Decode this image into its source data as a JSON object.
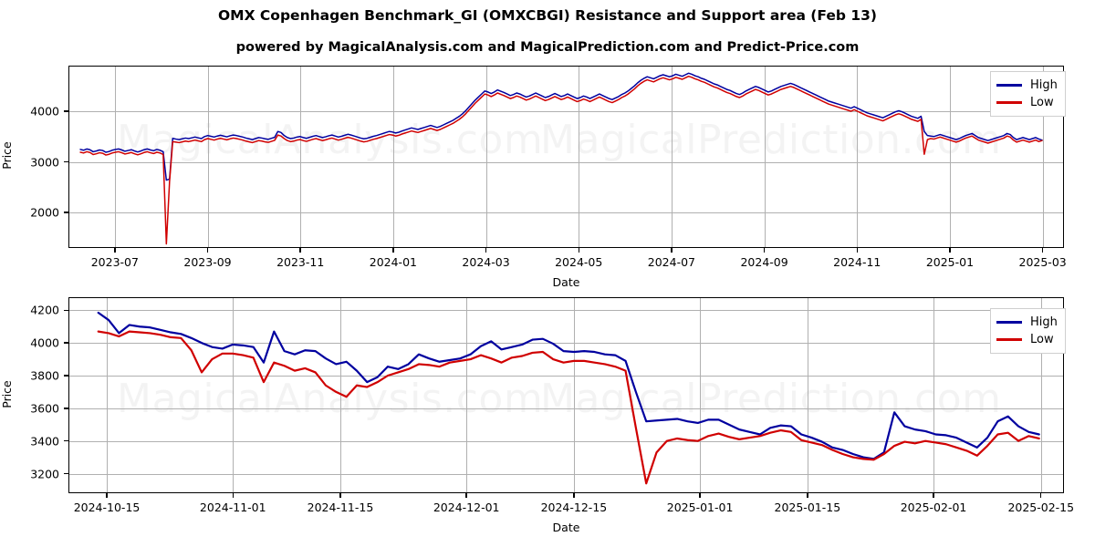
{
  "header": {
    "title": "OMX Copenhagen Benchmark_GI (OMXCBGI) Resistance and Support area (Feb 13)",
    "subtitle": "powered by MagicalAnalysis.com and MagicalPrediction.com and Predict-Price.com"
  },
  "watermarks": [
    "MagicalAnalysis.com",
    "MagicalPrediction.com"
  ],
  "colors": {
    "high": "#00009f",
    "low": "#d00000",
    "grid": "#b0b0b0",
    "axis": "#000000",
    "background": "#ffffff"
  },
  "legend": {
    "high_label": "High",
    "low_label": "Low"
  },
  "chart_data": [
    {
      "id": "top",
      "type": "line",
      "title": "OMX Copenhagen Benchmark_GI (OMXCBGI) Resistance and Support area (Feb 13)",
      "xlabel": "Date",
      "ylabel": "Price",
      "xlim": [
        "2023-06-01",
        "2025-03-15"
      ],
      "ylim": [
        1300,
        4900
      ],
      "grid": true,
      "legend_position": "top-right",
      "yticks": [
        2000,
        3000,
        4000
      ],
      "ytick_labels": [
        "2000",
        "3000",
        "4000"
      ],
      "xticks": [
        "2023-07",
        "2023-09",
        "2023-11",
        "2024-01",
        "2024-03",
        "2024-05",
        "2024-07",
        "2024-09",
        "2024-11",
        "2025-01",
        "2025-03"
      ],
      "series": [
        {
          "name": "High",
          "color": "#00009f",
          "values": [
            3245,
            3230,
            3255,
            3240,
            3200,
            3215,
            3235,
            3225,
            3190,
            3205,
            3230,
            3245,
            3255,
            3235,
            3210,
            3225,
            3240,
            3215,
            3195,
            3215,
            3240,
            3255,
            3235,
            3220,
            3245,
            3230,
            3200,
            2640,
            2660,
            3465,
            3450,
            3440,
            3455,
            3470,
            3460,
            3475,
            3490,
            3475,
            3460,
            3500,
            3520,
            3505,
            3490,
            3510,
            3525,
            3510,
            3495,
            3515,
            3530,
            3520,
            3505,
            3490,
            3470,
            3455,
            3440,
            3460,
            3480,
            3470,
            3455,
            3445,
            3465,
            3485,
            3600,
            3580,
            3520,
            3480,
            3460,
            3470,
            3490,
            3500,
            3480,
            3465,
            3485,
            3505,
            3520,
            3500,
            3480,
            3495,
            3515,
            3530,
            3510,
            3490,
            3505,
            3525,
            3545,
            3530,
            3510,
            3490,
            3470,
            3455,
            3465,
            3485,
            3505,
            3520,
            3540,
            3560,
            3580,
            3600,
            3590,
            3570,
            3585,
            3610,
            3630,
            3650,
            3670,
            3655,
            3640,
            3660,
            3680,
            3700,
            3720,
            3700,
            3680,
            3700,
            3730,
            3760,
            3790,
            3820,
            3860,
            3900,
            3950,
            4010,
            4080,
            4150,
            4220,
            4280,
            4340,
            4400,
            4380,
            4350,
            4380,
            4420,
            4395,
            4370,
            4340,
            4310,
            4330,
            4360,
            4340,
            4310,
            4280,
            4300,
            4330,
            4360,
            4330,
            4300,
            4270,
            4290,
            4320,
            4350,
            4320,
            4290,
            4310,
            4340,
            4310,
            4280,
            4250,
            4270,
            4300,
            4280,
            4250,
            4280,
            4310,
            4340,
            4310,
            4280,
            4250,
            4230,
            4260,
            4290,
            4330,
            4360,
            4400,
            4450,
            4500,
            4560,
            4610,
            4650,
            4680,
            4660,
            4640,
            4670,
            4700,
            4720,
            4700,
            4680,
            4700,
            4730,
            4710,
            4690,
            4720,
            4750,
            4730,
            4700,
            4680,
            4650,
            4630,
            4600,
            4570,
            4540,
            4520,
            4490,
            4460,
            4430,
            4410,
            4380,
            4350,
            4330,
            4360,
            4400,
            4430,
            4460,
            4490,
            4470,
            4440,
            4410,
            4380,
            4400,
            4430,
            4460,
            4490,
            4510,
            4530,
            4550,
            4530,
            4500,
            4470,
            4440,
            4410,
            4380,
            4350,
            4320,
            4290,
            4260,
            4230,
            4200,
            4180,
            4160,
            4140,
            4120,
            4100,
            4080,
            4060,
            4090,
            4060,
            4030,
            4000,
            3970,
            3950,
            3930,
            3910,
            3890,
            3870,
            3900,
            3930,
            3960,
            3990,
            4010,
            3990,
            3960,
            3930,
            3900,
            3880,
            3860,
            3900,
            3600,
            3520,
            3510,
            3500,
            3520,
            3540,
            3520,
            3500,
            3480,
            3460,
            3440,
            3460,
            3490,
            3520,
            3540,
            3560,
            3520,
            3480,
            3460,
            3440,
            3420,
            3440,
            3460,
            3480,
            3500,
            3520,
            3560,
            3540,
            3480,
            3440,
            3460,
            3480,
            3460,
            3440,
            3460,
            3480,
            3450,
            3430
          ]
        },
        {
          "name": "Low",
          "color": "#d00000",
          "values": [
            3190,
            3175,
            3200,
            3185,
            3145,
            3160,
            3180,
            3170,
            3135,
            3150,
            3175,
            3190,
            3200,
            3180,
            3155,
            3170,
            3185,
            3160,
            3140,
            3160,
            3185,
            3200,
            3180,
            3165,
            3190,
            3175,
            3145,
            1380,
            2610,
            3400,
            3390,
            3380,
            3395,
            3410,
            3400,
            3415,
            3430,
            3415,
            3400,
            3440,
            3460,
            3445,
            3430,
            3450,
            3465,
            3450,
            3435,
            3455,
            3470,
            3460,
            3445,
            3430,
            3410,
            3395,
            3380,
            3400,
            3420,
            3410,
            3395,
            3385,
            3405,
            3425,
            3530,
            3510,
            3460,
            3420,
            3400,
            3410,
            3430,
            3440,
            3420,
            3405,
            3425,
            3445,
            3460,
            3440,
            3420,
            3435,
            3455,
            3470,
            3450,
            3430,
            3445,
            3465,
            3485,
            3470,
            3450,
            3430,
            3410,
            3395,
            3405,
            3425,
            3445,
            3460,
            3480,
            3500,
            3520,
            3540,
            3530,
            3510,
            3525,
            3550,
            3570,
            3590,
            3610,
            3595,
            3580,
            3600,
            3620,
            3640,
            3660,
            3640,
            3620,
            3640,
            3670,
            3700,
            3730,
            3760,
            3800,
            3840,
            3890,
            3950,
            4020,
            4090,
            4160,
            4220,
            4280,
            4340,
            4320,
            4290,
            4320,
            4360,
            4335,
            4310,
            4280,
            4250,
            4270,
            4300,
            4280,
            4250,
            4220,
            4240,
            4270,
            4300,
            4270,
            4240,
            4210,
            4230,
            4260,
            4290,
            4260,
            4230,
            4250,
            4280,
            4250,
            4220,
            4190,
            4210,
            4240,
            4220,
            4190,
            4220,
            4250,
            4280,
            4250,
            4220,
            4190,
            4170,
            4200,
            4230,
            4270,
            4300,
            4340,
            4390,
            4440,
            4500,
            4550,
            4590,
            4620,
            4600,
            4580,
            4610,
            4640,
            4660,
            4640,
            4620,
            4640,
            4670,
            4650,
            4630,
            4660,
            4690,
            4670,
            4640,
            4620,
            4590,
            4570,
            4540,
            4510,
            4480,
            4460,
            4430,
            4400,
            4370,
            4350,
            4320,
            4290,
            4270,
            4300,
            4340,
            4370,
            4400,
            4430,
            4410,
            4380,
            4350,
            4320,
            4340,
            4370,
            4400,
            4430,
            4450,
            4470,
            4490,
            4470,
            4440,
            4410,
            4380,
            4350,
            4320,
            4290,
            4260,
            4230,
            4200,
            4170,
            4140,
            4120,
            4100,
            4080,
            4060,
            4040,
            4020,
            4000,
            4030,
            4000,
            3970,
            3940,
            3910,
            3890,
            3870,
            3850,
            3830,
            3810,
            3840,
            3870,
            3900,
            3930,
            3950,
            3930,
            3900,
            3870,
            3840,
            3820,
            3800,
            3840,
            3150,
            3440,
            3460,
            3450,
            3470,
            3490,
            3470,
            3450,
            3430,
            3410,
            3390,
            3410,
            3440,
            3470,
            3490,
            3510,
            3470,
            3430,
            3410,
            3390,
            3370,
            3390,
            3410,
            3430,
            3450,
            3470,
            3510,
            3490,
            3430,
            3390,
            3410,
            3430,
            3410,
            3390,
            3410,
            3430,
            3400,
            3420
          ]
        }
      ]
    },
    {
      "id": "bottom",
      "type": "line",
      "xlabel": "Date",
      "ylabel": "Price",
      "xlim": [
        "2024-10-10",
        "2025-02-18"
      ],
      "ylim": [
        3080,
        4280
      ],
      "grid": true,
      "legend_position": "top-right",
      "yticks": [
        3200,
        3400,
        3600,
        3800,
        4000,
        4200
      ],
      "ytick_labels": [
        "3200",
        "3400",
        "3600",
        "3800",
        "4000",
        "4200"
      ],
      "xticks": [
        "2024-10-15",
        "2024-11-01",
        "2024-11-15",
        "2024-12-01",
        "2024-12-15",
        "2025-01-01",
        "2025-01-15",
        "2025-02-01",
        "2025-02-15"
      ],
      "series": [
        {
          "name": "High",
          "color": "#00009f",
          "values": [
            4185,
            4140,
            4060,
            4110,
            4100,
            4095,
            4080,
            4065,
            4055,
            4030,
            4000,
            3975,
            3965,
            3990,
            3985,
            3975,
            3880,
            4070,
            3950,
            3930,
            3955,
            3950,
            3905,
            3870,
            3885,
            3830,
            3760,
            3790,
            3855,
            3840,
            3870,
            3930,
            3905,
            3885,
            3895,
            3905,
            3930,
            3980,
            4010,
            3960,
            3975,
            3990,
            4020,
            4025,
            3995,
            3950,
            3945,
            3950,
            3945,
            3930,
            3925,
            3890,
            3700,
            3520,
            3525,
            3530,
            3535,
            3520,
            3510,
            3530,
            3530,
            3500,
            3470,
            3455,
            3440,
            3480,
            3495,
            3490,
            3440,
            3420,
            3395,
            3360,
            3345,
            3320,
            3300,
            3290,
            3330,
            3575,
            3490,
            3470,
            3460,
            3440,
            3435,
            3420,
            3390,
            3360,
            3420,
            3520,
            3550,
            3490,
            3455,
            3440
          ]
        },
        {
          "name": "Low",
          "color": "#d00000",
          "values": [
            4070,
            4060,
            4040,
            4070,
            4065,
            4060,
            4050,
            4035,
            4030,
            3955,
            3820,
            3900,
            3935,
            3935,
            3925,
            3910,
            3760,
            3880,
            3860,
            3830,
            3845,
            3820,
            3740,
            3700,
            3670,
            3740,
            3730,
            3760,
            3800,
            3820,
            3840,
            3870,
            3865,
            3855,
            3880,
            3890,
            3900,
            3925,
            3905,
            3880,
            3910,
            3920,
            3940,
            3945,
            3900,
            3880,
            3890,
            3890,
            3880,
            3870,
            3855,
            3830,
            3480,
            3140,
            3330,
            3400,
            3415,
            3405,
            3400,
            3430,
            3445,
            3425,
            3410,
            3420,
            3430,
            3450,
            3465,
            3455,
            3405,
            3390,
            3375,
            3345,
            3320,
            3300,
            3290,
            3285,
            3320,
            3370,
            3395,
            3385,
            3400,
            3390,
            3380,
            3360,
            3340,
            3310,
            3370,
            3440,
            3450,
            3400,
            3430,
            3415
          ]
        }
      ]
    }
  ]
}
